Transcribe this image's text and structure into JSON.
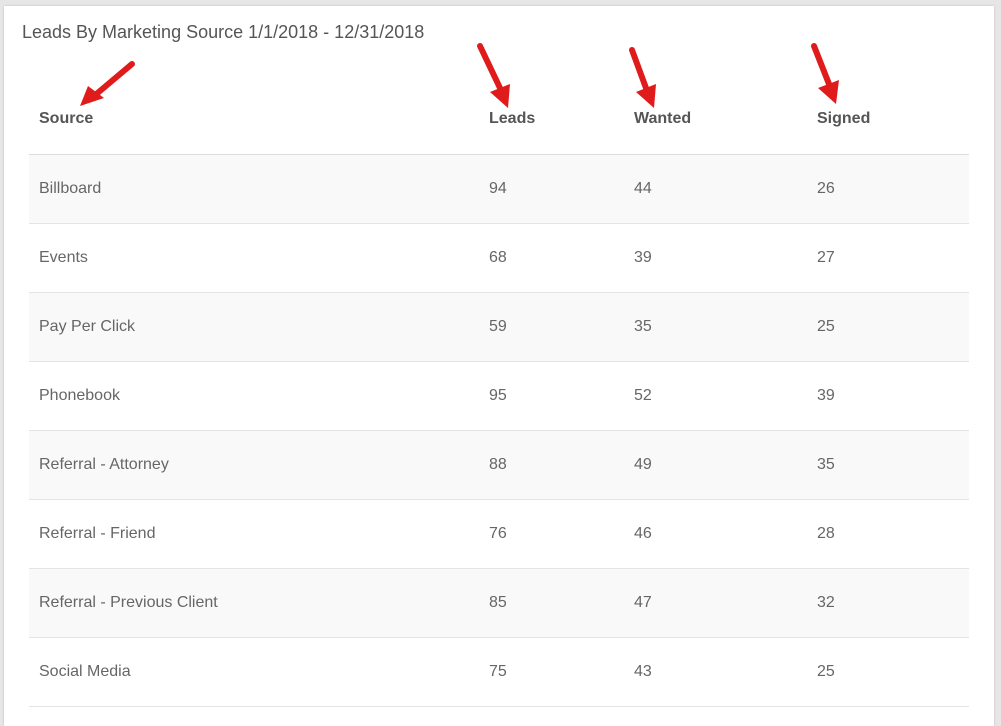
{
  "report": {
    "title": "Leads By Marketing Source 1/1/2018 - 12/31/2018"
  },
  "table": {
    "columns": [
      "Source",
      "Leads",
      "Wanted",
      "Signed"
    ],
    "rows": [
      {
        "source": "Billboard",
        "leads": "94",
        "wanted": "44",
        "signed": "26"
      },
      {
        "source": "Events",
        "leads": "68",
        "wanted": "39",
        "signed": "27"
      },
      {
        "source": "Pay Per Click",
        "leads": "59",
        "wanted": "35",
        "signed": "25"
      },
      {
        "source": "Phonebook",
        "leads": "95",
        "wanted": "52",
        "signed": "39"
      },
      {
        "source": "Referral - Attorney",
        "leads": "88",
        "wanted": "49",
        "signed": "35"
      },
      {
        "source": "Referral - Friend",
        "leads": "76",
        "wanted": "46",
        "signed": "28"
      },
      {
        "source": "Referral - Previous Client",
        "leads": "85",
        "wanted": "47",
        "signed": "32"
      },
      {
        "source": "Social Media",
        "leads": "75",
        "wanted": "43",
        "signed": "25"
      }
    ]
  },
  "annotations": {
    "arrow_color": "#e01b1b",
    "arrow_icon": "red-arrow-icon"
  }
}
